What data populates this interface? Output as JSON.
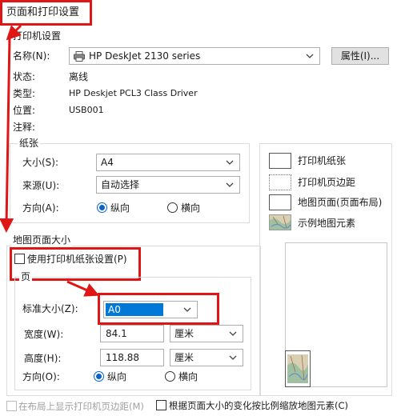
{
  "window": {
    "title": "页面和打印设置"
  },
  "printer": {
    "group_title": "打印机设置",
    "name_label": "名称(N):",
    "name_value": "HP DeskJet 2130 series",
    "properties_button": "属性(I)...",
    "status_label": "状态:",
    "status_value": "离线",
    "type_label": "类型:",
    "type_value": "HP Deskjet PCL3 Class Driver",
    "location_label": "位置:",
    "location_value": "USB001",
    "comment_label": "注释:"
  },
  "paper": {
    "group_title": "纸张",
    "size_label": "大小(S):",
    "size_value": "A4",
    "source_label": "来源(U):",
    "source_value": "自动选择",
    "orientation_label": "方向(A):",
    "portrait": "纵向",
    "landscape": "横向"
  },
  "legend": {
    "printer_paper": "打印机纸张",
    "printer_margin": "打印机页边距",
    "map_page": "地图页面(页面布局)",
    "sample_elements": "示例地图元素"
  },
  "map_page": {
    "group_title": "地图页面大小",
    "use_printer_paper": "使用打印机纸张设置(P)",
    "page_group_title": "页",
    "standard_size_label": "标准大小(Z):",
    "standard_size_value": "A0",
    "width_label": "宽度(W):",
    "width_value": "84.1",
    "width_unit": "厘米",
    "height_label": "高度(H):",
    "height_value": "118.88",
    "height_unit": "厘米",
    "orientation_label": "方向(O):",
    "portrait": "纵向",
    "landscape": "横向"
  },
  "bottom": {
    "show_margins": "在布局上显示打印机页边距(M)",
    "scale_elements": "根据页面大小的变化按比例缩放地图元素(C)"
  },
  "colors": {
    "accent": "#0a64c8",
    "highlight": "#e01515",
    "selection": "#0078d7"
  }
}
